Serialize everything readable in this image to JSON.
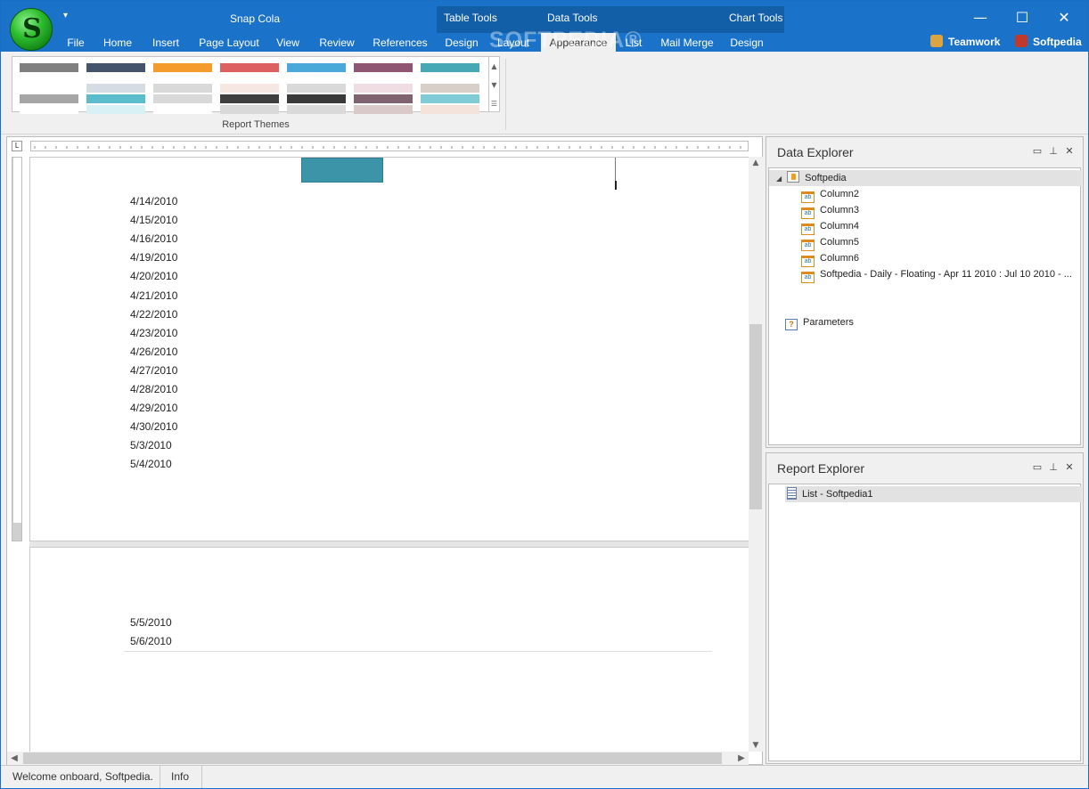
{
  "window": {
    "title": "Snap Cola",
    "quick_access": "▾",
    "controls": {
      "minimize": "—",
      "maximize": "☐",
      "close": "✕"
    }
  },
  "contextual_groups": [
    {
      "label": "Table Tools"
    },
    {
      "label": "Data Tools"
    },
    {
      "label": "Chart Tools"
    }
  ],
  "tabs": [
    {
      "label": "File"
    },
    {
      "label": "Home"
    },
    {
      "label": "Insert"
    },
    {
      "label": "Page Layout"
    },
    {
      "label": "View"
    },
    {
      "label": "Review"
    },
    {
      "label": "References"
    },
    {
      "label": "Design"
    },
    {
      "label": "Layout"
    },
    {
      "label": "Appearance"
    },
    {
      "label": "List"
    },
    {
      "label": "Mail Merge"
    },
    {
      "label": "Design"
    }
  ],
  "active_tab": "Appearance",
  "watermark": "SOFTPEDIA®",
  "users": [
    {
      "label": "Teamwork",
      "icon": "teamwork-icon"
    },
    {
      "label": "Softpedia",
      "icon": "user-icon"
    }
  ],
  "ribbon": {
    "group_label": "Report Themes",
    "themes": [
      {
        "colors": [
          "#7f7f7f",
          "#ffffff",
          "#a6a6a6",
          "#ffffff"
        ]
      },
      {
        "colors": [
          "#44546a",
          "#d6dce4",
          "#5bbccc",
          "#d7f1f5"
        ]
      },
      {
        "colors": [
          "#f59a2c",
          "#d9d9d9",
          "#d9d9d9",
          "#ffffff"
        ]
      },
      {
        "colors": [
          "#dd5f5f",
          "#f7e7e3",
          "#3f3f3f",
          "#d9d9d9"
        ]
      },
      {
        "colors": [
          "#49a9d9",
          "#d9d9d9",
          "#3a3a3a",
          "#d9d9d9"
        ]
      },
      {
        "colors": [
          "#8f5673",
          "#f0dde3",
          "#7f6470",
          "#d9c9c9"
        ]
      },
      {
        "colors": [
          "#46a8b5",
          "#d8d0c8",
          "#81cbd6",
          "#f4e3da"
        ]
      }
    ]
  },
  "report": {
    "page1_dates": [
      "4/14/2010",
      "4/15/2010",
      "4/16/2010",
      "4/19/2010",
      "4/20/2010",
      "4/21/2010",
      "4/22/2010",
      "4/23/2010",
      "4/26/2010",
      "4/27/2010",
      "4/28/2010",
      "4/29/2010",
      "4/30/2010",
      "5/3/2010",
      "5/4/2010"
    ],
    "page2_dates": [
      "5/5/2010",
      "5/6/2010"
    ],
    "header_cell_color": "#3c94a8"
  },
  "data_explorer": {
    "title": "Data Explorer",
    "root": "Softpedia",
    "columns": [
      "Column2",
      "Column3",
      "Column4",
      "Column5",
      "Column6",
      "Softpedia - Daily - Floating - Apr 11 2010 : Jul 10 2010 - ..."
    ],
    "parameters": "Parameters"
  },
  "report_explorer": {
    "title": "Report Explorer",
    "items": [
      "List - Softpedia1"
    ]
  },
  "status_bar": {
    "message": "Welcome onboard, Softpedia.",
    "info": "Info"
  }
}
